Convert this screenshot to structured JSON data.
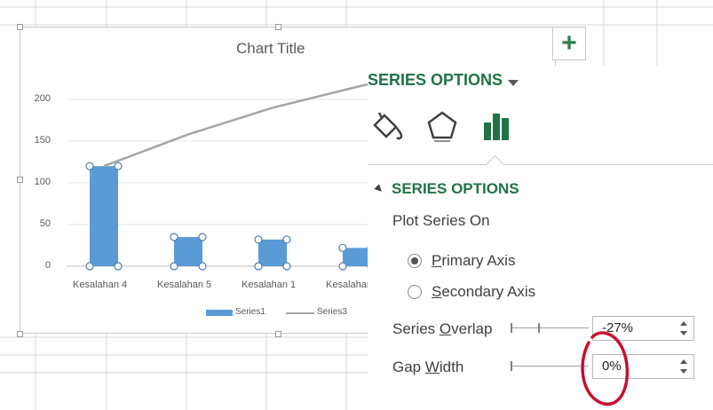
{
  "chart": {
    "title": "Chart Title",
    "plus_symbol": "+"
  },
  "chart_data": {
    "type": "bar",
    "title": "Chart Title",
    "categories": [
      "Kesalahan 4",
      "Kesalahan 5",
      "Kesalahan 1",
      "Kesalahan"
    ],
    "series": [
      {
        "name": "Series1",
        "type": "bar",
        "values": [
          120,
          35,
          32,
          22
        ]
      },
      {
        "name": "Series3",
        "type": "line",
        "values": [
          120,
          158,
          190,
          215
        ]
      }
    ],
    "yticks": [
      "0",
      "50",
      "100",
      "150",
      "200"
    ],
    "ylim": [
      0,
      225
    ],
    "legend": "bottom",
    "colors": {
      "Series1": "#5b9bd5",
      "Series3": "#a5a5a5"
    }
  },
  "panel": {
    "header": "SERIES OPTIONS",
    "section_title": "SERIES OPTIONS",
    "plot_series_on": "Plot Series On",
    "primary_axis": {
      "accel": "P",
      "rest": "rimary Axis",
      "selected": true
    },
    "secondary_axis": {
      "accel": "S",
      "rest": "econdary Axis",
      "selected": false
    },
    "series_overlap": {
      "pre": "Series ",
      "accel": "O",
      "post": "verlap",
      "value": "-27%"
    },
    "gap_width": {
      "pre": "Gap ",
      "accel": "W",
      "post": "idth",
      "value": "0%"
    },
    "tabs": [
      "fill-line-icon",
      "effects-pentagon-icon",
      "series-options-bars-icon"
    ],
    "accent": "#217346"
  }
}
